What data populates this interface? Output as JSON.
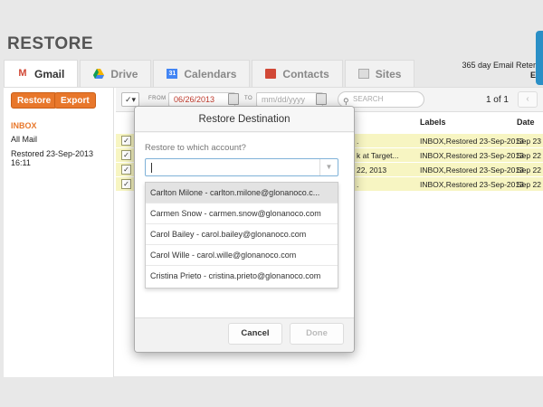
{
  "page": {
    "title": "RESTORE"
  },
  "retention": {
    "line1": "365 day Email Reter",
    "line2": "E"
  },
  "tabs": [
    {
      "label": "Gmail",
      "icon": "gmail-icon",
      "color": "#d14836"
    },
    {
      "label": "Drive",
      "icon": "drive-icon",
      "color": "#f4b400"
    },
    {
      "label": "Calendars",
      "icon": "calendar-icon",
      "color": "#4285f4",
      "icon_text": "31"
    },
    {
      "label": "Contacts",
      "icon": "contacts-icon",
      "color": "#d14836"
    },
    {
      "label": "Sites",
      "icon": "sites-icon",
      "color": "#9e9e9e"
    }
  ],
  "sidebar": {
    "restore_label": "Restore",
    "export_label": "Export",
    "folders": [
      "INBOX",
      "All Mail",
      "Restored 23-Sep-2013 16:11"
    ]
  },
  "toolbar": {
    "from_label": "FROM",
    "from_value": "06/26/2013",
    "to_label": "TO",
    "to_placeholder": "mm/dd/yyyy",
    "search_placeholder": "SEARCH",
    "pager": "1 of 1",
    "prev": "‹"
  },
  "columns": {
    "labels": "Labels",
    "date": "Date"
  },
  "rows": [
    {
      "subject": ".",
      "labels": "INBOX,Restored 23-Sep-2013",
      "date": "Sep 23"
    },
    {
      "subject": "k at Target...",
      "labels": "INBOX,Restored 23-Sep-2013",
      "date": "Sep 22"
    },
    {
      "subject": "22, 2013",
      "labels": "INBOX,Restored 23-Sep-2013",
      "date": "Sep 22"
    },
    {
      "subject": ".",
      "labels": "INBOX,Restored 23-Sep-2013",
      "date": "Sep 22"
    }
  ],
  "modal": {
    "title": "Restore Destination",
    "prompt": "Restore to which account?",
    "options": [
      "Carlton Milone - carlton.milone@glonanoco.c...",
      "Carmen Snow - carmen.snow@glonanoco.com",
      "Carol Bailey - carol.bailey@glonanoco.com",
      "Carol Wille - carol.wille@glonanoco.com",
      "Cristina Prieto - cristina.prieto@glonanoco.com"
    ],
    "cancel_label": "Cancel",
    "done_label": "Done"
  },
  "colors": {
    "accent": "#e8772b",
    "highlight_row": "#f7f5c2",
    "brand_blue": "#2a8fc6"
  }
}
